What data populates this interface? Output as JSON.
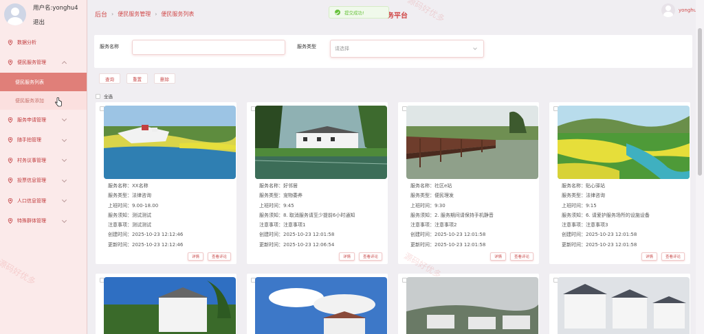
{
  "user": {
    "name": "用户名:yonghu4",
    "logout": "退出"
  },
  "sidebar": {
    "items": [
      {
        "label": "数据分析"
      },
      {
        "label": "便民服务管理"
      },
      {
        "label": "服务申请管理"
      },
      {
        "label": "随手拍管理"
      },
      {
        "label": "村务议事管理"
      },
      {
        "label": "投票信息管理"
      },
      {
        "label": "人口信息管理"
      },
      {
        "label": "特殊群体管理"
      }
    ],
    "sub_items": [
      {
        "label": "便民服务列表"
      },
      {
        "label": "便民服务添加"
      }
    ]
  },
  "breadcrumb": {
    "home": "后台",
    "level1": "便民服务管理",
    "level2": "便民服务列表"
  },
  "header": {
    "title": "村服务平台",
    "username": "yonghu4"
  },
  "toast": {
    "message": "提交成功!"
  },
  "search": {
    "name_label": "服务名称",
    "name_value": "",
    "type_label": "服务类型",
    "type_placeholder": "请选择"
  },
  "actions": {
    "query": "查询",
    "reset": "重置",
    "delete": "删除",
    "select_all": "全选"
  },
  "card_buttons": {
    "detail": "详情",
    "reviews": "查看评论"
  },
  "cards": [
    {
      "name": "服务名称：XX名称",
      "type": "服务类型：法律咨询",
      "hours": "上班时间：9.00-18.00",
      "notice": "服务须知：测试测试",
      "notes": "注意事项：测试测试",
      "created": "创建时间：2025-10-23 12:12:46",
      "updated": "更新时间：2025-10-23 12:12:46"
    },
    {
      "name": "服务名称：好邻居",
      "type": "服务类型：宠物委养",
      "hours": "上班时间：9:45",
      "notice": "服务须知：8. 取消服务请至少提前6小时通知",
      "notes": "注意事项：注意事项1",
      "created": "创建时间：2025-10-23 12:01:58",
      "updated": "更新时间：2025-10-23 12:06:54"
    },
    {
      "name": "服务名称：社区e站",
      "type": "服务类型：便民理发",
      "hours": "上班时间：9:30",
      "notice": "服务须知：2. 服务期间请保持手机静音",
      "notes": "注意事项：注意事项2",
      "created": "创建时间：2025-10-23 12:01:58",
      "updated": "更新时间：2025-10-23 12:01:58"
    },
    {
      "name": "服务名称：贴心驿站",
      "type": "服务类型：法律咨询",
      "hours": "上班时间：9:15",
      "notice": "服务须知：6. 请爱护服务场所的设施设备",
      "notes": "注意事项：注意事项3",
      "created": "创建时间：2025-10-23 12:01:58",
      "updated": "更新时间：2025-10-23 12:01:58"
    }
  ],
  "watermarks": [
    "源码好优多",
    "源码好优多",
    "源码好优多"
  ],
  "colors": {
    "accent": "#d04848",
    "sidebar_bg": "#fbeaea",
    "active_menu": "#e07f79",
    "success": "#67c23a"
  },
  "icons": [
    "location-pin-icon",
    "chevron-down-icon",
    "check-circle-icon",
    "user-avatar-icon",
    "pointer-cursor-icon"
  ]
}
